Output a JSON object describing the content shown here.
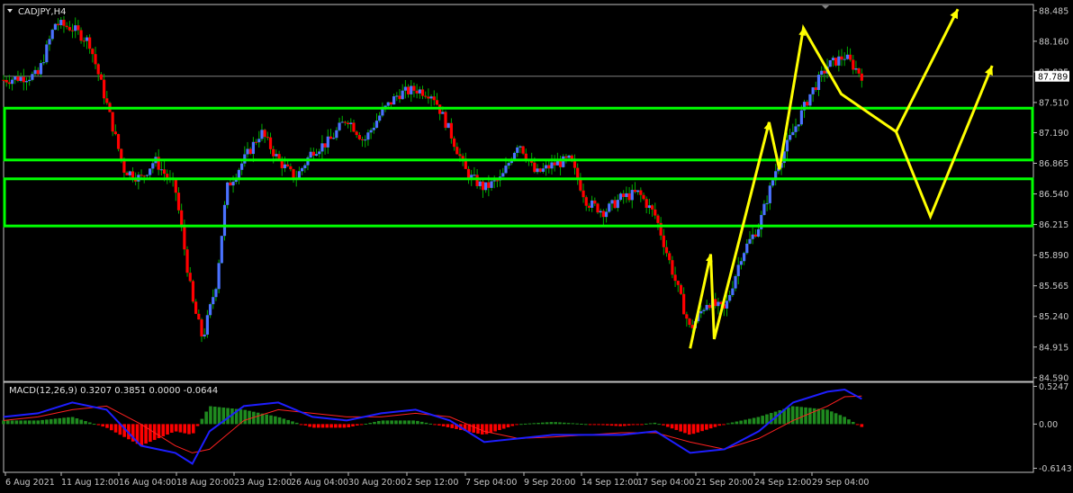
{
  "chart_data": [
    {
      "type": "candlestick",
      "title": "CADJPY,H4",
      "current_price": "87.789",
      "y_ticks": [
        "88.485",
        "88.160",
        "87.835",
        "87.510",
        "87.190",
        "86.865",
        "86.540",
        "86.215",
        "85.890",
        "85.565",
        "85.240",
        "84.915",
        "84.590"
      ],
      "x_ticks": [
        "6 Aug 2021",
        "11 Aug 12:00",
        "16 Aug 04:00",
        "18 Aug 20:00",
        "23 Aug 12:00",
        "26 Aug 04:00",
        "30 Aug 20:00",
        "2 Sep 12:00",
        "7 Sep 04:00",
        "9 Sep 20:00",
        "14 Sep 12:00",
        "17 Sep 04:00",
        "21 Sep 20:00",
        "24 Sep 12:00",
        "29 Sep 04:00"
      ],
      "ylim": [
        84.55,
        88.55
      ],
      "approx_close_path": [
        [
          0,
          87.75
        ],
        [
          1.0,
          87.8
        ],
        [
          1.5,
          88.35
        ],
        [
          2.0,
          88.3
        ],
        [
          2.5,
          88.15
        ],
        [
          3.0,
          87.5
        ],
        [
          3.5,
          86.8
        ],
        [
          4.0,
          86.7
        ],
        [
          4.4,
          86.9
        ],
        [
          5.0,
          86.6
        ],
        [
          5.5,
          85.4
        ],
        [
          5.8,
          85.0
        ],
        [
          6.2,
          85.6
        ],
        [
          6.5,
          86.6
        ],
        [
          7.0,
          86.9
        ],
        [
          7.5,
          87.2
        ],
        [
          8.0,
          86.9
        ],
        [
          8.5,
          86.7
        ],
        [
          9.0,
          87.0
        ],
        [
          9.5,
          87.1
        ],
        [
          10.0,
          87.35
        ],
        [
          10.5,
          87.1
        ],
        [
          11.0,
          87.4
        ],
        [
          11.5,
          87.6
        ],
        [
          12.0,
          87.65
        ],
        [
          12.5,
          87.6
        ],
        [
          13.0,
          87.2
        ],
        [
          13.5,
          86.75
        ],
        [
          14.0,
          86.6
        ],
        [
          14.5,
          86.7
        ],
        [
          15.0,
          87.1
        ],
        [
          15.5,
          86.75
        ],
        [
          16.0,
          86.85
        ],
        [
          16.5,
          86.9
        ],
        [
          17.0,
          86.45
        ],
        [
          17.5,
          86.35
        ],
        [
          18.0,
          86.5
        ],
        [
          18.5,
          86.55
        ],
        [
          19.0,
          86.3
        ],
        [
          19.5,
          85.7
        ],
        [
          20.0,
          85.1
        ],
        [
          20.5,
          85.4
        ],
        [
          21.0,
          85.3
        ],
        [
          21.5,
          85.9
        ],
        [
          22.0,
          86.2
        ],
        [
          22.5,
          86.8
        ],
        [
          23.0,
          87.2
        ],
        [
          23.5,
          87.6
        ],
        [
          24.0,
          87.9
        ],
        [
          24.5,
          88.0
        ],
        [
          25.0,
          87.8
        ]
      ],
      "support_resistance_zones": [
        {
          "from": 86.9,
          "to": 87.45
        },
        {
          "from": 86.2,
          "to": 86.7
        }
      ],
      "projection_arrows": [
        [
          [
            20.0,
            84.9
          ],
          [
            20.6,
            85.9
          ],
          [
            20.7,
            85.0
          ],
          [
            22.3,
            87.3
          ],
          [
            22.6,
            86.8
          ],
          [
            23.3,
            88.3
          ],
          [
            24.4,
            87.6
          ],
          [
            26.0,
            87.2
          ],
          [
            27.8,
            88.5
          ]
        ],
        [
          [
            26.0,
            87.2
          ],
          [
            27.0,
            86.3
          ],
          [
            28.8,
            87.9
          ]
        ]
      ],
      "colors": {
        "bull": "#4a72ff",
        "bear": "#ff0000",
        "wick": "#00b000",
        "zone": "#00ff00",
        "arrow": "#ffff00"
      }
    },
    {
      "type": "macd",
      "title": "MACD(12,26,9) 0.3207 0.3851 0.0000 -0.0644",
      "y_ticks": [
        "0.5247",
        "0.00",
        "-0.6143"
      ],
      "ylim": [
        -0.67,
        0.58
      ],
      "main": [
        [
          0,
          0.1
        ],
        [
          1,
          0.15
        ],
        [
          2,
          0.3
        ],
        [
          3,
          0.2
        ],
        [
          4,
          -0.3
        ],
        [
          5,
          -0.4
        ],
        [
          5.5,
          -0.55
        ],
        [
          6,
          -0.1
        ],
        [
          7,
          0.25
        ],
        [
          8,
          0.3
        ],
        [
          9,
          0.1
        ],
        [
          10,
          0.05
        ],
        [
          11,
          0.15
        ],
        [
          12,
          0.2
        ],
        [
          13,
          0.05
        ],
        [
          14,
          -0.25
        ],
        [
          15,
          -0.2
        ],
        [
          16,
          -0.15
        ],
        [
          17,
          -0.15
        ],
        [
          18,
          -0.15
        ],
        [
          19,
          -0.1
        ],
        [
          20,
          -0.4
        ],
        [
          21,
          -0.35
        ],
        [
          22,
          -0.1
        ],
        [
          23,
          0.3
        ],
        [
          24,
          0.45
        ],
        [
          24.5,
          0.48
        ],
        [
          25,
          0.35
        ]
      ],
      "signal": [
        [
          0,
          0.05
        ],
        [
          1,
          0.1
        ],
        [
          2,
          0.2
        ],
        [
          3,
          0.25
        ],
        [
          4,
          0.0
        ],
        [
          5,
          -0.3
        ],
        [
          5.5,
          -0.4
        ],
        [
          6,
          -0.35
        ],
        [
          7,
          0.05
        ],
        [
          8,
          0.2
        ],
        [
          9,
          0.15
        ],
        [
          10,
          0.1
        ],
        [
          11,
          0.1
        ],
        [
          12,
          0.15
        ],
        [
          13,
          0.1
        ],
        [
          14,
          -0.1
        ],
        [
          15,
          -0.2
        ],
        [
          16,
          -0.18
        ],
        [
          17,
          -0.15
        ],
        [
          18,
          -0.12
        ],
        [
          19,
          -0.12
        ],
        [
          20,
          -0.25
        ],
        [
          21,
          -0.35
        ],
        [
          22,
          -0.2
        ],
        [
          23,
          0.05
        ],
        [
          24,
          0.25
        ],
        [
          24.5,
          0.38
        ],
        [
          25,
          0.39
        ]
      ],
      "colors": {
        "main": "#1e1eff",
        "signal": "#ff2020",
        "hist_pos": "#1f8a1f",
        "hist_neg": "#ff0000"
      }
    }
  ]
}
